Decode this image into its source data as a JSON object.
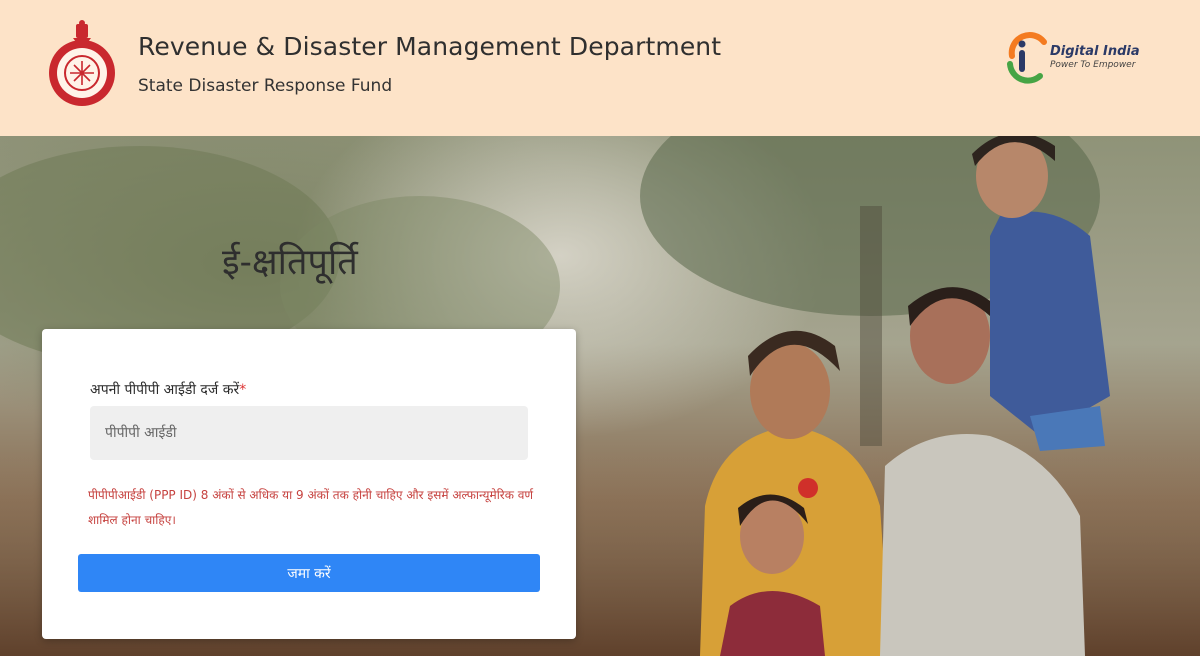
{
  "header": {
    "title": "Revenue & Disaster Management Department",
    "subtitle": "State Disaster Response Fund",
    "emblem_icon": "haryana-state-emblem-icon",
    "digital_india": {
      "title": "Digital India",
      "tagline": "Power To Empower",
      "icon": "digital-india-logo-icon"
    }
  },
  "main": {
    "app_name": "ई-क्षतिपूर्ति",
    "form": {
      "label": "अपनी पीपीपी आईडी दर्ज करें",
      "required_marker": "*",
      "input_value": "",
      "input_placeholder": "पीपीपी आईडी",
      "validation_message": "पीपीपीआईडी (PPP ID) 8 अंकों से अधिक या 9 अंकों तक होनी चाहिए और इसमें अल्फान्यूमेरिक वर्ण शामिल होना चाहिए।",
      "submit_label": "जमा करें"
    }
  },
  "colors": {
    "header_bg": "#fde3c8",
    "button_bg": "#2f86f6",
    "error_text": "#c6423f",
    "required_marker": "#dd3333"
  }
}
